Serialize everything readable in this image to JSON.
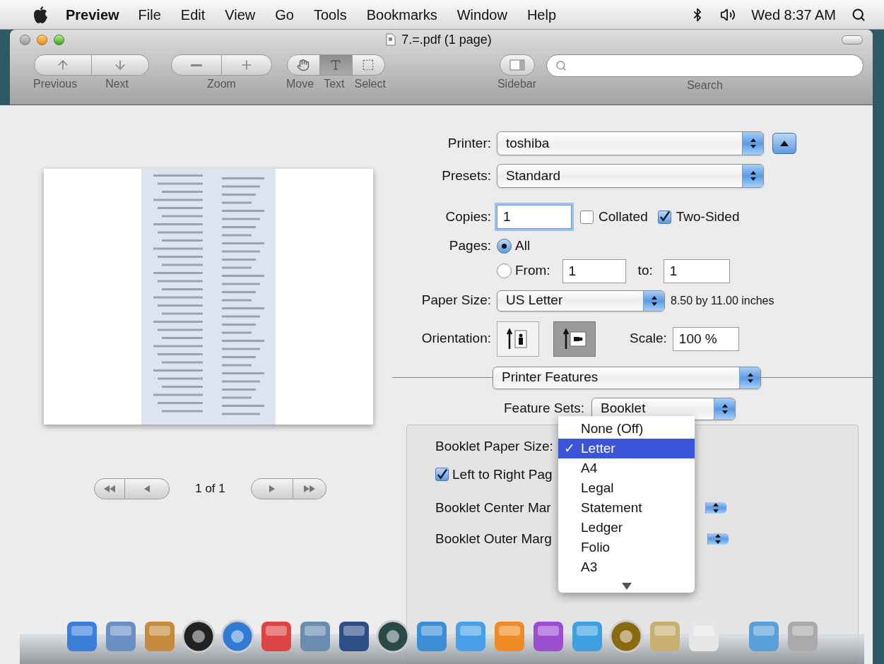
{
  "menu_bar": {
    "app": "Preview",
    "items": [
      "File",
      "Edit",
      "View",
      "Go",
      "Tools",
      "Bookmarks",
      "Window",
      "Help"
    ],
    "clock": "Wed 8:37 AM"
  },
  "window": {
    "title": "7.=.pdf (1 page)"
  },
  "toolbar": {
    "groups": [
      {
        "label_items": [
          {
            "label": "Previous"
          },
          {
            "label": "Next"
          }
        ]
      },
      {
        "label": "Zoom"
      },
      {
        "items": [
          {
            "label": "Move",
            "selected": false
          },
          {
            "label": "Text",
            "selected": true
          },
          {
            "label": "Select",
            "selected": false
          }
        ]
      },
      {
        "label": "Sidebar"
      }
    ],
    "search": {
      "label": "Search"
    }
  },
  "preview": {
    "page_indicator": "1 of 1"
  },
  "print": {
    "printer": {
      "label": "Printer:",
      "value": "toshiba"
    },
    "presets": {
      "label": "Presets:",
      "value": "Standard"
    },
    "copies": {
      "label": "Copies:",
      "value": "1"
    },
    "collated": {
      "label": "Collated",
      "checked": false
    },
    "two_sided": {
      "label": "Two-Sided",
      "checked": true
    },
    "pages": {
      "label": "Pages:",
      "all": {
        "label": "All",
        "selected": true
      },
      "from": {
        "label": "From:",
        "selected": false,
        "value": "1"
      },
      "to": {
        "label": "to:",
        "value": "1"
      }
    },
    "paper_size": {
      "label": "Paper Size:",
      "value": "US Letter",
      "note": "8.50 by 11.00 inches"
    },
    "orientation": {
      "label": "Orientation:",
      "options": [
        {
          "kind": "portrait",
          "selected": false
        },
        {
          "kind": "landscape",
          "selected": true
        }
      ]
    },
    "scale": {
      "label": "Scale:",
      "value": "100 %"
    },
    "section": "Printer Features",
    "feature_sets": {
      "label": "Feature Sets:",
      "value": "Booklet"
    },
    "booklet": {
      "paper_size_label": "Booklet Paper Size:",
      "left_to_right": {
        "label": "Left to Right Pag",
        "checked": true
      },
      "center_margin_label": "Booklet Center Mar",
      "outer_margin_label": "Booklet Outer Marg"
    }
  },
  "menu": {
    "items": [
      {
        "label": "None (Off)",
        "selected": false
      },
      {
        "label": "Letter",
        "selected": true
      },
      {
        "label": "A4",
        "selected": false
      },
      {
        "label": "Legal",
        "selected": false
      },
      {
        "label": "Statement",
        "selected": false
      },
      {
        "label": "Ledger",
        "selected": false
      },
      {
        "label": "Folio",
        "selected": false
      },
      {
        "label": "A3",
        "selected": false
      }
    ],
    "check": "✓"
  }
}
